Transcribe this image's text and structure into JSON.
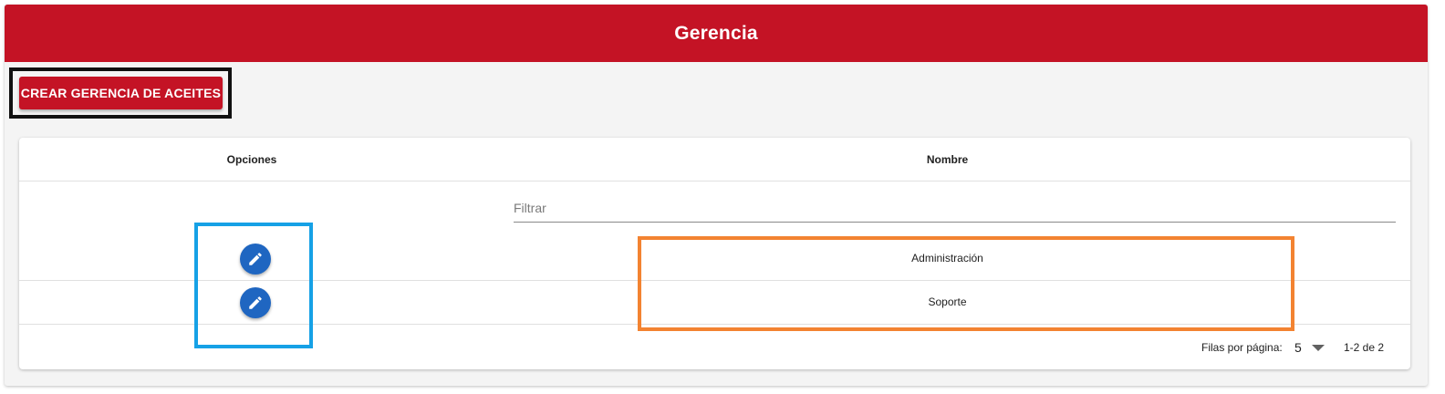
{
  "header": {
    "title": "Gerencia",
    "color": "#c41325"
  },
  "actions": {
    "create_label": "CREAR GERENCIA DE ACEITES"
  },
  "table": {
    "columns": [
      "Opciones",
      "Nombre"
    ],
    "filter": {
      "placeholder": "Filtrar",
      "value": ""
    },
    "rows": [
      {
        "name": "Administración",
        "action_icon": "pencil-icon"
      },
      {
        "name": "Soporte",
        "action_icon": "pencil-icon"
      }
    ],
    "pagination": {
      "rows_per_page_label": "Filas por página:",
      "rows_per_page": "5",
      "range": "1-2 de 2"
    }
  },
  "annotations": {
    "black_box_color": "#111111",
    "blue_box_color": "#16a1e6",
    "orange_box_color": "#f38331"
  }
}
